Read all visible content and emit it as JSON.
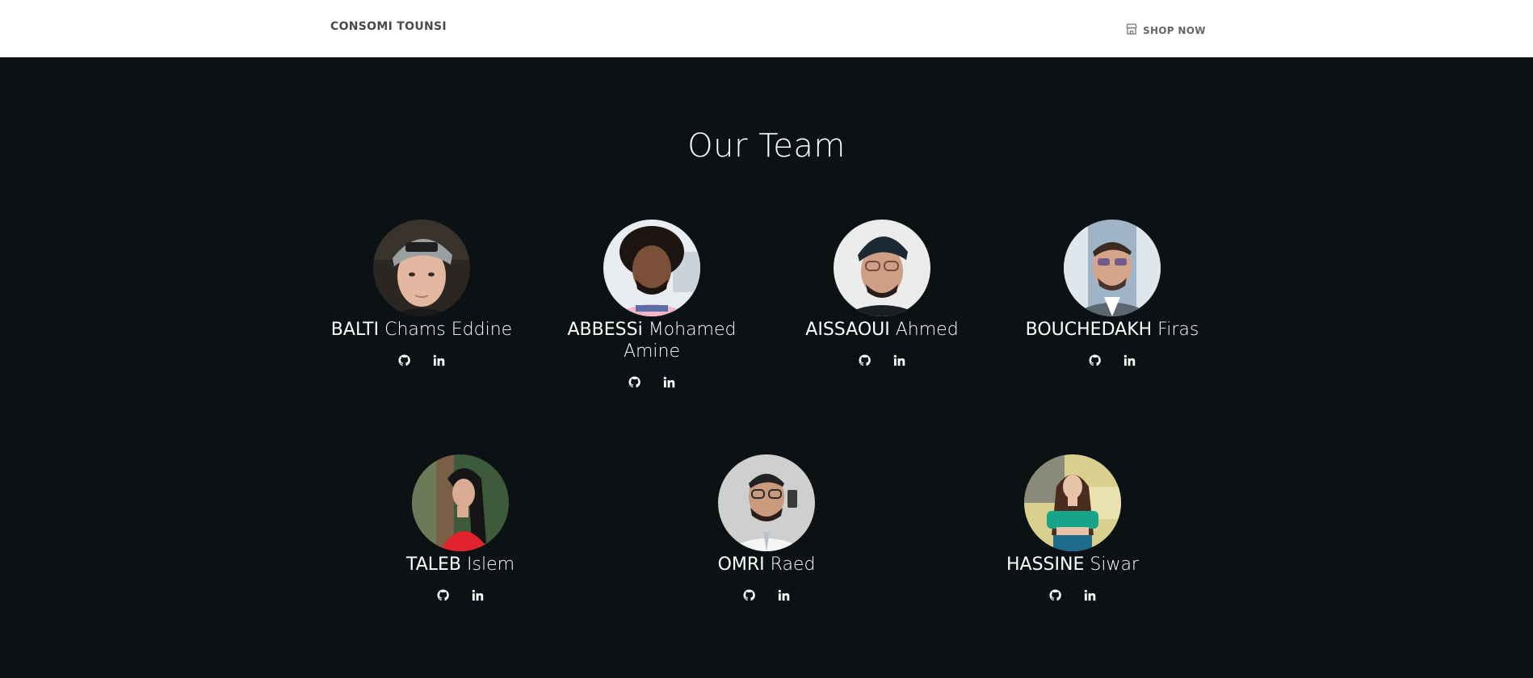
{
  "navbar": {
    "brand": "CONSOMI TOUNSI",
    "shop_label": "SHOP NOW",
    "shop_icon": "storefront-icon"
  },
  "team": {
    "title": "Our Team",
    "members": [
      {
        "last_name": "BALTI",
        "first_name": "Chams Eddine",
        "social": [
          "github-icon",
          "linkedin-icon"
        ]
      },
      {
        "last_name": "ABBESSi",
        "first_name": "Mohamed Amine",
        "social": [
          "github-icon",
          "linkedin-icon"
        ]
      },
      {
        "last_name": "AISSAOUI",
        "first_name": "Ahmed",
        "social": [
          "github-icon",
          "linkedin-icon"
        ]
      },
      {
        "last_name": "BOUCHEDAKH",
        "first_name": "Firas",
        "social": [
          "github-icon",
          "linkedin-icon"
        ]
      },
      {
        "last_name": "TALEB",
        "first_name": "Islem",
        "social": [
          "github-icon",
          "linkedin-icon"
        ]
      },
      {
        "last_name": "OMRI",
        "first_name": "Raed",
        "social": [
          "github-icon",
          "linkedin-icon"
        ]
      },
      {
        "last_name": "HASSINE",
        "first_name": "Siwar",
        "social": [
          "github-icon",
          "linkedin-icon"
        ]
      }
    ]
  },
  "colors": {
    "background": "#0c1213",
    "navbar": "#ffffff",
    "text": "#ffffff"
  }
}
